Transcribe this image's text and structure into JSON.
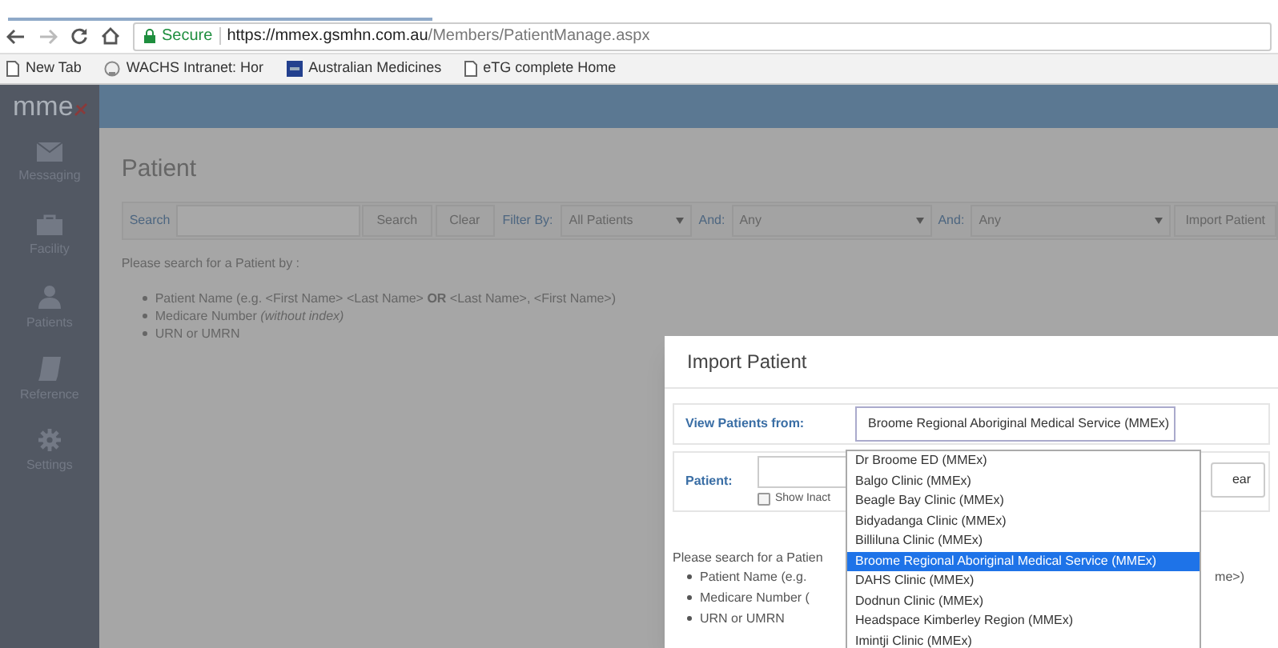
{
  "browser": {
    "secure_label": "Secure",
    "url_host": "https://mmex.gsmhn.com.au",
    "url_path": "/Members/PatientManage.aspx",
    "bookmarks": [
      {
        "kind": "page",
        "label": "New Tab"
      },
      {
        "kind": "globe",
        "label": "WACHS Intranet: Hor"
      },
      {
        "kind": "amh",
        "label": "Australian Medicines"
      },
      {
        "kind": "page",
        "label": "eTG complete Home"
      }
    ]
  },
  "app": {
    "logo": "mme",
    "sidebar": [
      {
        "kind": "envelope",
        "label": "Messaging"
      },
      {
        "kind": "briefcase",
        "label": "Facility"
      },
      {
        "kind": "person",
        "label": "Patients"
      },
      {
        "kind": "book",
        "label": "Reference"
      },
      {
        "kind": "gear",
        "label": "Settings"
      }
    ],
    "page_title": "Patient",
    "toolbar": {
      "search_label": "Search",
      "search_button": "Search",
      "clear_button": "Clear",
      "filter_label": "Filter By:",
      "filter_value": "All Patients",
      "and_filters": [
        {
          "label": "And:",
          "value": "Any"
        },
        {
          "label": "And:",
          "value": "Any"
        }
      ],
      "import_button": "Import Patient"
    },
    "intro": "Please search for a Patient by :",
    "criteria": [
      "Patient Name (e.g. <First Name> <Last Name> **OR** <Last Name>, <First Name>)",
      "Medicare Number *(without index)*",
      "URN or UMRN"
    ]
  },
  "modal": {
    "title": "Import Patient",
    "view_label": "View Patients from:",
    "view_value": "Broome Regional Aboriginal Medical Service (MMEx)",
    "patient_label": "Patient:",
    "clear_button": "ear",
    "show_inactive": {
      "label": "Show Inact",
      "checked": false
    },
    "intro": "Please search for a Patien",
    "criteria": [
      "Patient Name (e.g.",
      "Medicare Number (",
      "URN or UMRN"
    ],
    "criteria_tail": "me>)",
    "options": [
      {
        "label": "Dr Broome ED (MMEx)",
        "selected": false
      },
      {
        "label": "Balgo Clinic (MMEx)",
        "selected": false
      },
      {
        "label": "Beagle Bay Clinic (MMEx)",
        "selected": false
      },
      {
        "label": "Bidyadanga Clinic (MMEx)",
        "selected": false
      },
      {
        "label": "Billiluna Clinic (MMEx)",
        "selected": false
      },
      {
        "label": "Broome Regional Aboriginal Medical Service (MMEx)",
        "selected": true
      },
      {
        "label": "DAHS Clinic (MMEx)",
        "selected": false
      },
      {
        "label": "Dodnun Clinic (MMEx)",
        "selected": false
      },
      {
        "label": "Headspace Kimberley Region (MMEx)",
        "selected": false
      },
      {
        "label": "Imintji Clinic (MMEx)",
        "selected": false
      }
    ]
  }
}
